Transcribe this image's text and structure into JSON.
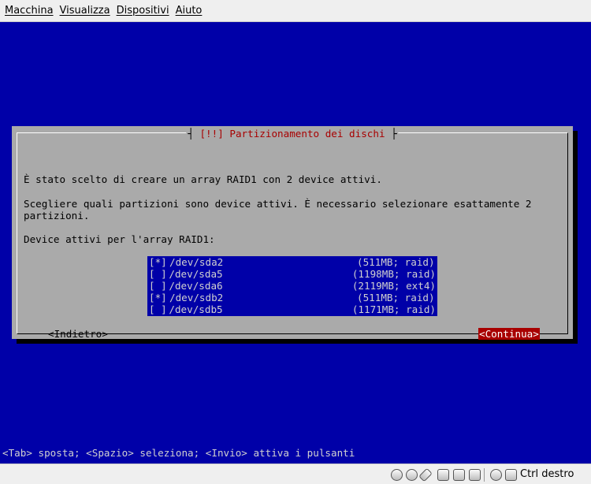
{
  "menubar": {
    "items": [
      "Macchina",
      "Visualizza",
      "Dispositivi",
      "Aiuto"
    ]
  },
  "dialog": {
    "title_ticks": "┤ ",
    "title": "[!!] Partizionamento dei dischi",
    "title_ticks_end": " ├",
    "line1": "È stato scelto di creare un array RAID1 con 2 device attivi.",
    "line2": "Scegliere quali partizioni sono device attivi. È necessario selezionare esattamente 2",
    "line3": "partizioni.",
    "line4": "Device attivi per l'array RAID1:",
    "devices": [
      {
        "check": "[*]",
        "name": "/dev/sda2",
        "info": "(511MB; raid)"
      },
      {
        "check": "[ ]",
        "name": "/dev/sda5",
        "info": "(1198MB; raid)"
      },
      {
        "check": "[ ]",
        "name": "/dev/sda6",
        "info": "(2119MB; ext4)"
      },
      {
        "check": "[*]",
        "name": "/dev/sdb2",
        "info": "(511MB; raid)"
      },
      {
        "check": "[ ]",
        "name": "/dev/sdb5",
        "info": "(1171MB; raid)"
      }
    ],
    "back_button": "<Indietro>",
    "continue_button": "<Continua>"
  },
  "help_line": "<Tab> sposta; <Spazio> seleziona; <Invio> attiva i pulsanti",
  "statusbar": {
    "icons": [
      "hard-disk-icon",
      "cd-icon",
      "usb-icon",
      "network-icon",
      "shared-folder-icon",
      "display-icon",
      "capture-icon",
      "mouse-integration-icon",
      "host-key-icon"
    ],
    "host_key": "Ctrl destro"
  }
}
